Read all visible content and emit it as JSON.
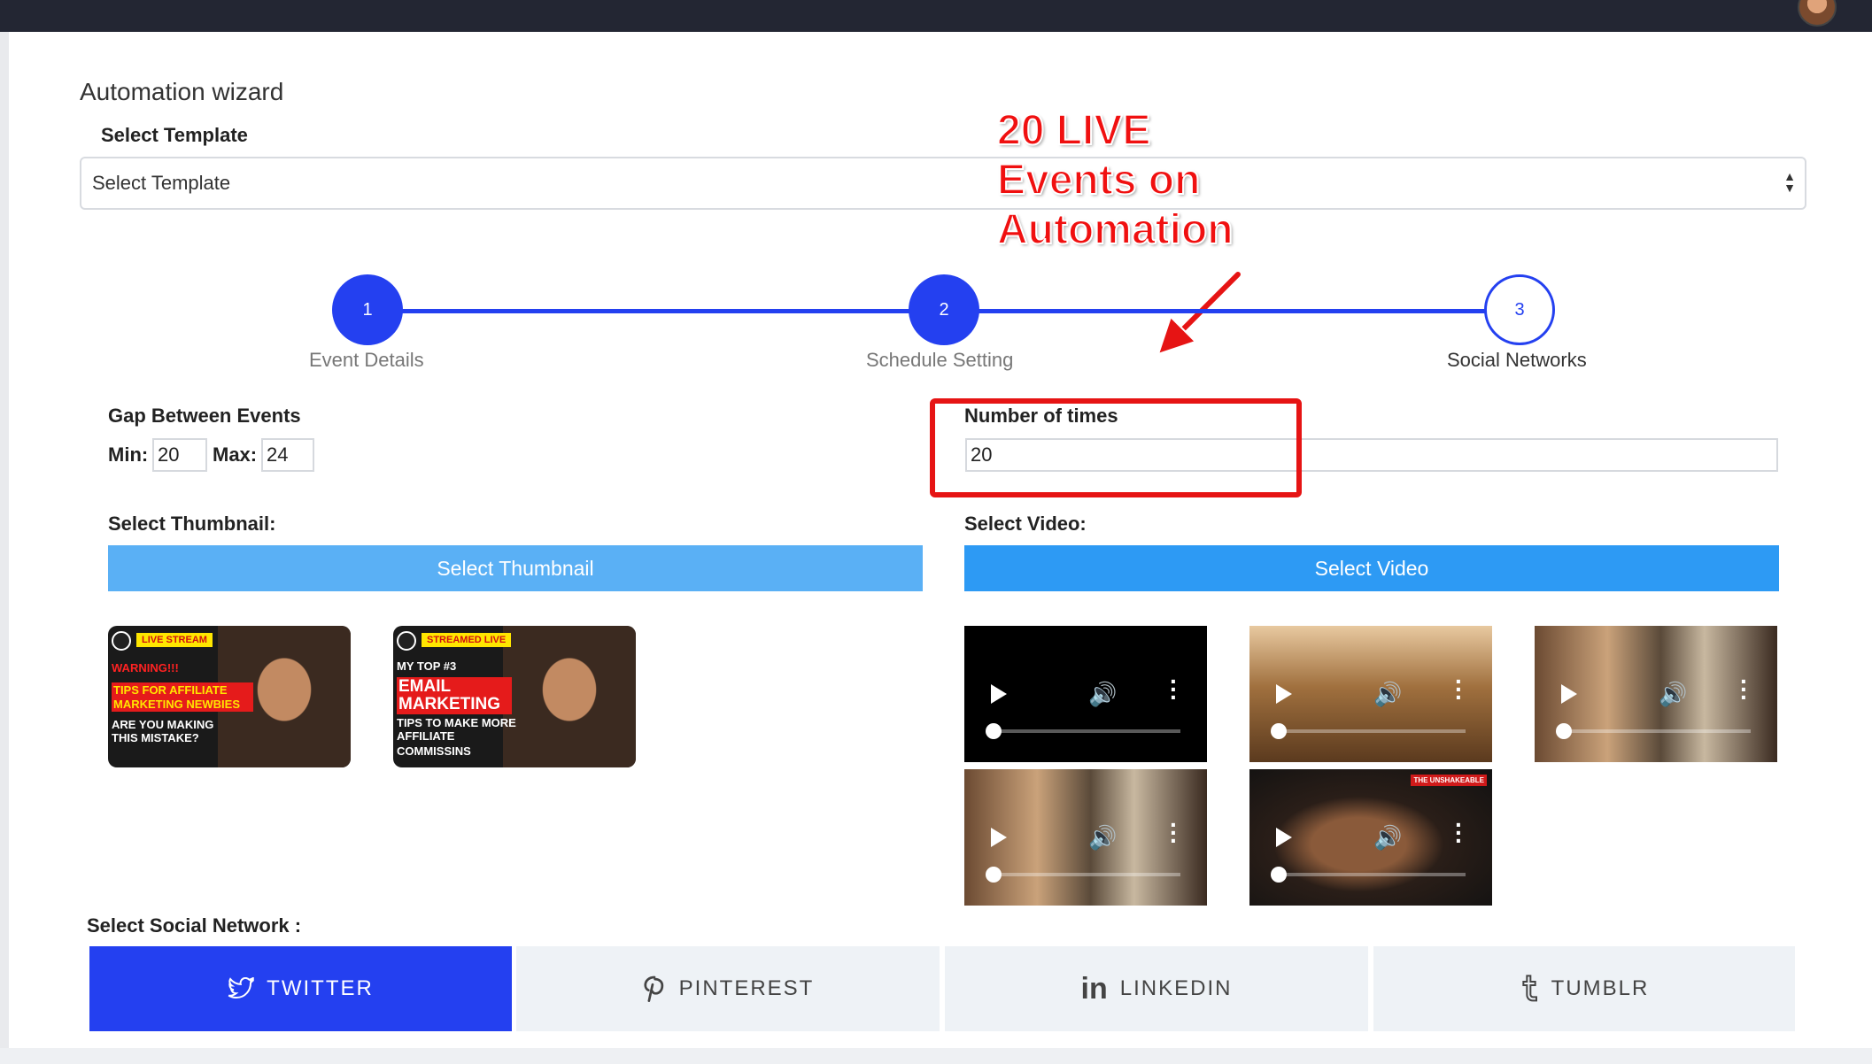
{
  "wizard": {
    "title": "Automation wizard"
  },
  "template": {
    "label": "Select Template",
    "selected": "Select Template"
  },
  "annotation": {
    "line1": "20 LIVE",
    "line2": "Events on",
    "line3": "Automation"
  },
  "steps": [
    {
      "number": "1",
      "label": "Event Details",
      "state": "complete"
    },
    {
      "number": "2",
      "label": "Schedule Setting",
      "state": "complete"
    },
    {
      "number": "3",
      "label": "Social Networks",
      "state": "current"
    }
  ],
  "gap": {
    "label": "Gap Between Events",
    "min_label": "Min:",
    "min_value": "20",
    "max_label": "Max:",
    "max_value": "24"
  },
  "times": {
    "label": "Number of times",
    "value": "20"
  },
  "thumbnail": {
    "label": "Select Thumbnail:",
    "button": "Select Thumbnail"
  },
  "video": {
    "label": "Select Video:",
    "button": "Select Video"
  },
  "thumbnails": [
    {
      "tag": "Live Stream",
      "l1": "Warning!!!",
      "l2": "Tips for affiliate",
      "l3": "marketing newbies",
      "l4": "Are you making",
      "l5": "this mistake?"
    },
    {
      "tag": "Streamed Live",
      "l1": "My Top #3",
      "l2": "Email",
      "l3": "Marketing",
      "l4": "Tips to make more affiliate",
      "l5": "commissins"
    }
  ],
  "videos_badge": "THE UNSHAKEABLE",
  "social": {
    "label": "Select Social Network :",
    "tabs": [
      {
        "label": "TWITTER",
        "icon": "twitter-icon",
        "active": true
      },
      {
        "label": "PINTEREST",
        "icon": "pinterest-icon",
        "active": false
      },
      {
        "label": "LINKEDIN",
        "icon": "linkedin-icon",
        "active": false
      },
      {
        "label": "TUMBLR",
        "icon": "tumblr-icon",
        "active": false
      }
    ]
  },
  "colors": {
    "accent": "#2440f0",
    "button_light": "#5ab0f5",
    "button_strong": "#2d9af4",
    "annotation": "#f01010",
    "topbar": "#232633"
  }
}
